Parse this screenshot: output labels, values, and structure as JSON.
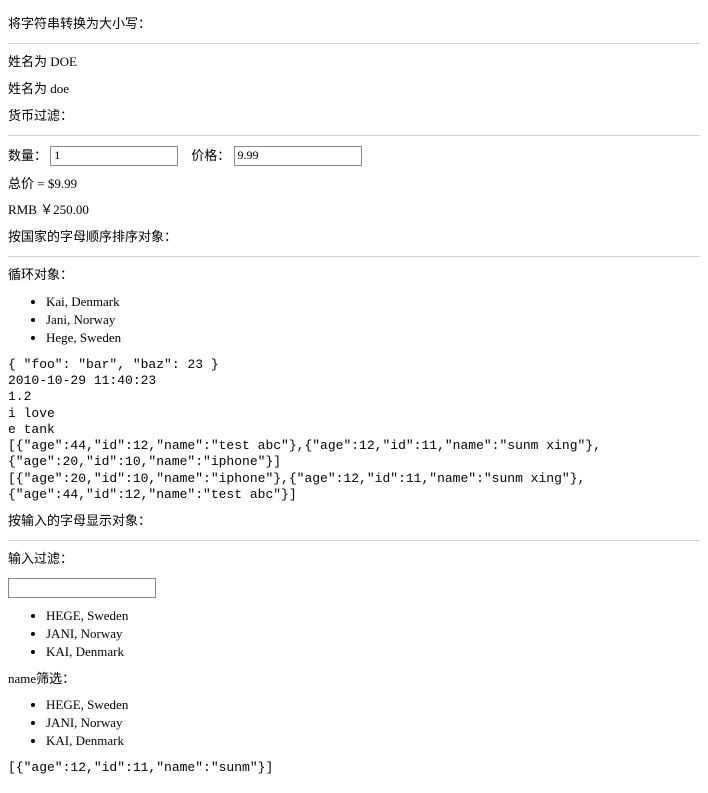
{
  "section1": {
    "title": "将字符串转换为大小写：",
    "name_upper_label": "姓名为 DOE",
    "name_lower_label": "姓名为 doe"
  },
  "section2": {
    "title": "货币过滤：",
    "qty_label": "数量：",
    "qty_value": "1",
    "price_label": "价格：",
    "price_value": "9.99",
    "total_line": "总价 = $9.99",
    "rmb_line": "RMB  ￥250.00"
  },
  "section3": {
    "title": "按国家的字母顺序排序对象：",
    "loop_title": "循环对象：",
    "list1": [
      "Kai, Denmark",
      "Jani, Norway",
      "Hege, Sweden"
    ]
  },
  "codeblock": {
    "l1": "{ \"foo\": \"bar\", \"baz\": 23 }",
    "l2": "2010-10-29 11:40:23",
    "l3": "1.2",
    "l4": "i love",
    "l5": "e tank",
    "l6": "[{\"age\":44,\"id\":12,\"name\":\"test abc\"},{\"age\":12,\"id\":11,\"name\":\"sunm xing\"},{\"age\":20,\"id\":10,\"name\":\"iphone\"}]",
    "l7": "[{\"age\":20,\"id\":10,\"name\":\"iphone\"},{\"age\":12,\"id\":11,\"name\":\"sunm xing\"},{\"age\":44,\"id\":12,\"name\":\"test abc\"}]"
  },
  "section4": {
    "title": "按输入的字母显示对象：",
    "input_label": "输入过滤：",
    "filter_value": "",
    "list2": [
      "HEGE, Sweden",
      "JANI, Norway",
      "KAI, Denmark"
    ]
  },
  "section5": {
    "title": "name筛选：",
    "list3": [
      "HEGE, Sweden",
      "JANI, Norway",
      "KAI, Denmark"
    ],
    "bottom_line": "[{\"age\":12,\"id\":11,\"name\":\"sunm\"}]"
  }
}
